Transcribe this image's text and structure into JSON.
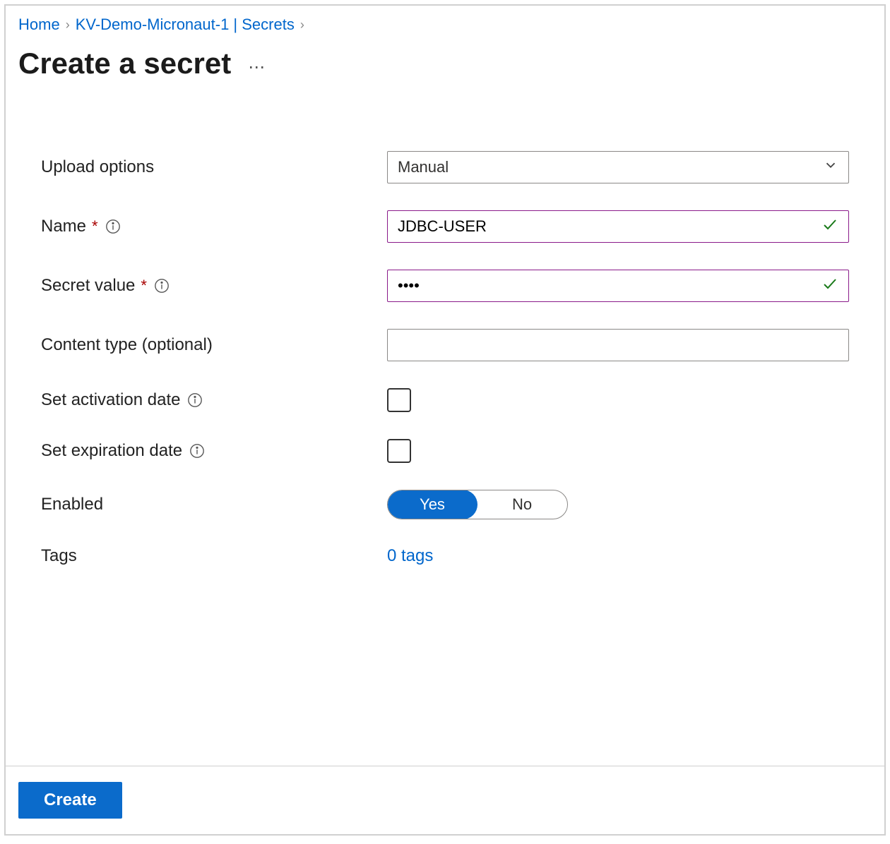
{
  "breadcrumb": {
    "items": [
      {
        "label": "Home"
      },
      {
        "label": "KV-Demo-Micronaut-1 | Secrets"
      }
    ]
  },
  "page": {
    "title": "Create a secret"
  },
  "form": {
    "upload_options": {
      "label": "Upload options",
      "value": "Manual"
    },
    "name": {
      "label": "Name",
      "value": "JDBC-USER"
    },
    "secret_value": {
      "label": "Secret value",
      "value": "••••"
    },
    "content_type": {
      "label": "Content type (optional)",
      "value": ""
    },
    "activation_date": {
      "label": "Set activation date",
      "checked": false
    },
    "expiration_date": {
      "label": "Set expiration date",
      "checked": false
    },
    "enabled": {
      "label": "Enabled",
      "options": {
        "yes": "Yes",
        "no": "No"
      },
      "value": "Yes"
    },
    "tags": {
      "label": "Tags",
      "link_text": "0 tags"
    }
  },
  "actions": {
    "create": "Create"
  }
}
